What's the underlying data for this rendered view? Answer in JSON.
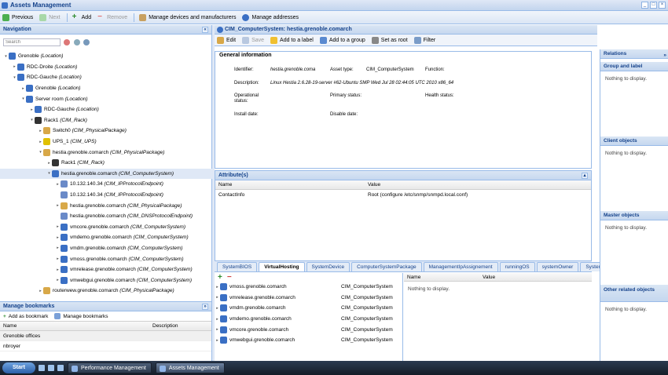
{
  "window": {
    "title": "Assets Management",
    "ctrl": [
      "_",
      "□",
      "×"
    ]
  },
  "toolbar": [
    {
      "label": "Previous",
      "enabled": true
    },
    {
      "label": "Next",
      "enabled": false
    },
    {
      "label": "Add",
      "enabled": true
    },
    {
      "label": "Remove",
      "enabled": false
    },
    {
      "label": "Manage devices and manufacturers",
      "enabled": true
    },
    {
      "label": "Manage addresses",
      "enabled": true
    }
  ],
  "navigation": {
    "title": "Navigation",
    "search_placeholder": "Search",
    "tree": [
      {
        "name": "Grenoble",
        "type": "(Location)",
        "depth": 0,
        "tog": "▾"
      },
      {
        "name": "RDC-Droite",
        "type": "(Location)",
        "depth": 1,
        "tog": "▸"
      },
      {
        "name": "RDC-Gauche",
        "type": "(Location)",
        "depth": 1,
        "tog": "▾"
      },
      {
        "name": "Grenoble",
        "type": "(Location)",
        "depth": 2,
        "tog": "▸"
      },
      {
        "name": "Server room",
        "type": "(Location)",
        "depth": 2,
        "tog": "▾"
      },
      {
        "name": "RDC-Gauche",
        "type": "(Location)",
        "depth": 3,
        "tog": "▸"
      },
      {
        "name": "Rack1",
        "type": "(CIM_Rack)",
        "depth": 3,
        "tog": "▾"
      },
      {
        "name": "Switch0",
        "type": "(CIM_PhysicalPackage)",
        "depth": 4,
        "tog": "▸"
      },
      {
        "name": "UPS_1",
        "type": "(CIM_UPS)",
        "depth": 4,
        "tog": "▸"
      },
      {
        "name": "hestia.grenoble.comarch",
        "type": "(CIM_PhysicalPackage)",
        "depth": 4,
        "tog": "▾"
      },
      {
        "name": "Rack1",
        "type": "(CIM_Rack)",
        "depth": 5,
        "tog": "▸"
      },
      {
        "name": "hestia.grenoble.comarch",
        "type": "(CIM_ComputerSystem)",
        "depth": 5,
        "tog": "▾",
        "sel": true
      },
      {
        "name": "10.132.140.34",
        "type": "(CIM_IPProtocolEndpoint)",
        "depth": 6,
        "tog": "▸"
      },
      {
        "name": "10.132.140.34",
        "type": "(CIM_IPProtocolEndpoint)",
        "depth": 6,
        "tog": ""
      },
      {
        "name": "hestia.grenoble.comarch",
        "type": "(CIM_PhysicalPackage)",
        "depth": 6,
        "tog": "▸"
      },
      {
        "name": "hestia.grenoble.comarch",
        "type": "(CIM_DNSProtocolEndpoint)",
        "depth": 6,
        "tog": ""
      },
      {
        "name": "vmcore.grenoble.comarch",
        "type": "(CIM_ComputerSystem)",
        "depth": 6,
        "tog": "▸"
      },
      {
        "name": "vmdemo.grenoble.comarch",
        "type": "(CIM_ComputerSystem)",
        "depth": 6,
        "tog": "▸"
      },
      {
        "name": "vmdm.grenoble.comarch",
        "type": "(CIM_ComputerSystem)",
        "depth": 6,
        "tog": "▸"
      },
      {
        "name": "vmoss.grenoble.comarch",
        "type": "(CIM_ComputerSystem)",
        "depth": 6,
        "tog": "▸"
      },
      {
        "name": "vmrelease.grenoble.comarch",
        "type": "(CIM_ComputerSystem)",
        "depth": 6,
        "tog": "▸"
      },
      {
        "name": "vmwebgui.grenoble.comarch",
        "type": "(CIM_ComputerSystem)",
        "depth": 6,
        "tog": "▸"
      },
      {
        "name": "routerwew.grenoble.comarch",
        "type": "(CIM_PhysicalPackage)",
        "depth": 4,
        "tog": "▸"
      }
    ]
  },
  "bookmarks": {
    "title": "Manage bookmarks",
    "add_label": "Add as bookmark",
    "manage_label": "Manage bookmarks",
    "col_name": "Name",
    "col_desc": "Description",
    "rows": [
      "Grenoble offices",
      "nbroyer"
    ]
  },
  "main": {
    "title": "CIM_ComputerSystem: hestia.grenoble.comarch",
    "toolbar": [
      {
        "label": "Edit",
        "enabled": true
      },
      {
        "label": "Save",
        "enabled": false
      },
      {
        "label": "Add to a label",
        "enabled": true
      },
      {
        "label": "Add to a group",
        "enabled": true
      },
      {
        "label": "Set as root",
        "enabled": true
      },
      {
        "label": "Filter",
        "enabled": true
      }
    ],
    "general": {
      "title": "General information",
      "identifier_label": "Identifier:",
      "identifier": "hestia.grenoble.coma",
      "asset_type_label": "Asset type:",
      "asset_type": "CIM_ComputerSystem",
      "function_label": "Function:",
      "description_label": "Description:",
      "description": "Linux Hestia 2.6.28-19-server #62-Ubuntu SMP Wed Jul 28 02:44:05 UTC 2010 x86_64",
      "op_status_label_1": "Operational",
      "op_status_label_2": "status:",
      "primary_status_label": "Primary status:",
      "health_status_label": "Health status:",
      "install_date_label": "Install date:",
      "disable_date_label": "Disable date:"
    },
    "attributes": {
      "title": "Attribute(s)",
      "col_name": "Name",
      "col_value": "Value",
      "rows": [
        {
          "name": "ContactInfo",
          "value": "Root (configure /etc/snmp/snmpd.local.conf)"
        }
      ]
    },
    "tabs": [
      "SystemBIOS",
      "VirtualHosting",
      "SystemDevice",
      "ComputerSystemPackage",
      "ManagementIpAssignement",
      "runningOS",
      "systemOwner",
      "SystemI"
    ],
    "active_tab": "VirtualHosting",
    "vhosts": [
      {
        "name": "vmoss.grenoble.comarch",
        "type": "CIM_ComputerSystem"
      },
      {
        "name": "vmrelease.grenoble.comarch",
        "type": "CIM_ComputerSystem"
      },
      {
        "name": "vmdm.grenoble.comarch",
        "type": "CIM_ComputerSystem"
      },
      {
        "name": "vmdemo.grenoble.comarch",
        "type": "CIM_ComputerSystem"
      },
      {
        "name": "vmcore.grenoble.comarch",
        "type": "CIM_ComputerSystem"
      },
      {
        "name": "vmwebgui.grenoble.comarch",
        "type": "CIM_ComputerSystem"
      }
    ],
    "nv": {
      "col_name": "Name",
      "col_value": "Value",
      "empty": "Nothing to display."
    }
  },
  "relations": {
    "title": "Relations",
    "sections": [
      {
        "title": "Group and label",
        "empty": "Nothing to display."
      },
      {
        "title": "Client objects",
        "empty": "Nothing to display."
      },
      {
        "title": "Master objects",
        "empty": "Nothing to display."
      },
      {
        "title": "Other related objects",
        "empty": "Nothing to display."
      }
    ]
  },
  "taskbar": {
    "start": "Start",
    "tasks": [
      "Performance Management",
      "Assets Management"
    ]
  },
  "colors": {
    "accent": "#15428b",
    "panel": "#dfe8f6",
    "border": "#99bbe8"
  }
}
